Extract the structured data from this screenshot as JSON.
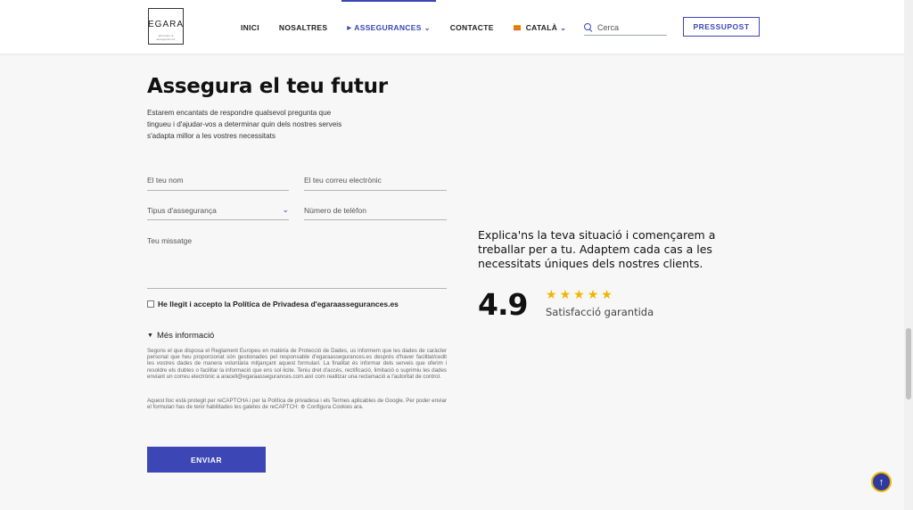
{
  "header": {
    "logo_text": "EGARA",
    "logo_sub": "advocats & assegurances",
    "nav": [
      {
        "label": "INICI"
      },
      {
        "label": "NOSALTRES"
      },
      {
        "label": "ASSEGURANCES"
      },
      {
        "label": "CONTACTE"
      },
      {
        "label": "CATALÀ"
      }
    ],
    "search_placeholder": "Cerca",
    "quote_button": "PRESSUPOST"
  },
  "form": {
    "title": "Assegura el teu futur",
    "intro": "Estarem encantats de respondre qualsevol pregunta que tingueu i d'ajudar-vos a determinar quin dels nostres serveis s'adapta millor a les vostres necessitats",
    "name_label": "El teu nom",
    "email_label": "El teu correu electrònic",
    "type_label": "Tipus d'assegurança",
    "phone_label": "Número de telèfon",
    "message_label": "Teu missatge",
    "consent_label": "He llegit i accepto la Política de Privadesa d'egaraassegurances.es",
    "more_info": "Més informació",
    "legal_text": "Segons el que disposa el Reglament Europeu en matèria de Protecció de Dades, us informem que les dades de caràcter personal que heu proporcionat són gestionades pel responsable d'egaraassegurances.es després d'haver facilitat/cedit les vostres dades de manera voluntària mitjançant aquest formulari. La finalitat és informar dels serveis que oferim i resoldre els dubtes o facilitar la informació que ens sol·licite. Teniu dret d'accés, rectificació, limitació o suprimiu les dades enviant un correu electrònic a aracell@egaraassegurances.com.així com realitzar una reclamació a l'autoritat de control.",
    "recaptcha_text": "Aquest lloc està protegit per reCAPTCHA i per la Política de privadesa i els Termes aplicables de Google. Per poder enviar el formulari has de tenir habilitades les galetes de reCAPTCH: ⚙ Configura Cookies ara.",
    "submit": "ENVIAR"
  },
  "aside": {
    "pitch": "Explica'ns la teva situació i començarem a treballar per a tu. Adaptem cada cas a les necessitats úniques dels nostres clients.",
    "rating_value": "4.9",
    "stars": 5,
    "rating_caption": "Satisfacció garantida"
  },
  "colors": {
    "accent": "#3c47b5",
    "star": "#f4b400",
    "background": "#f7f7f7"
  }
}
